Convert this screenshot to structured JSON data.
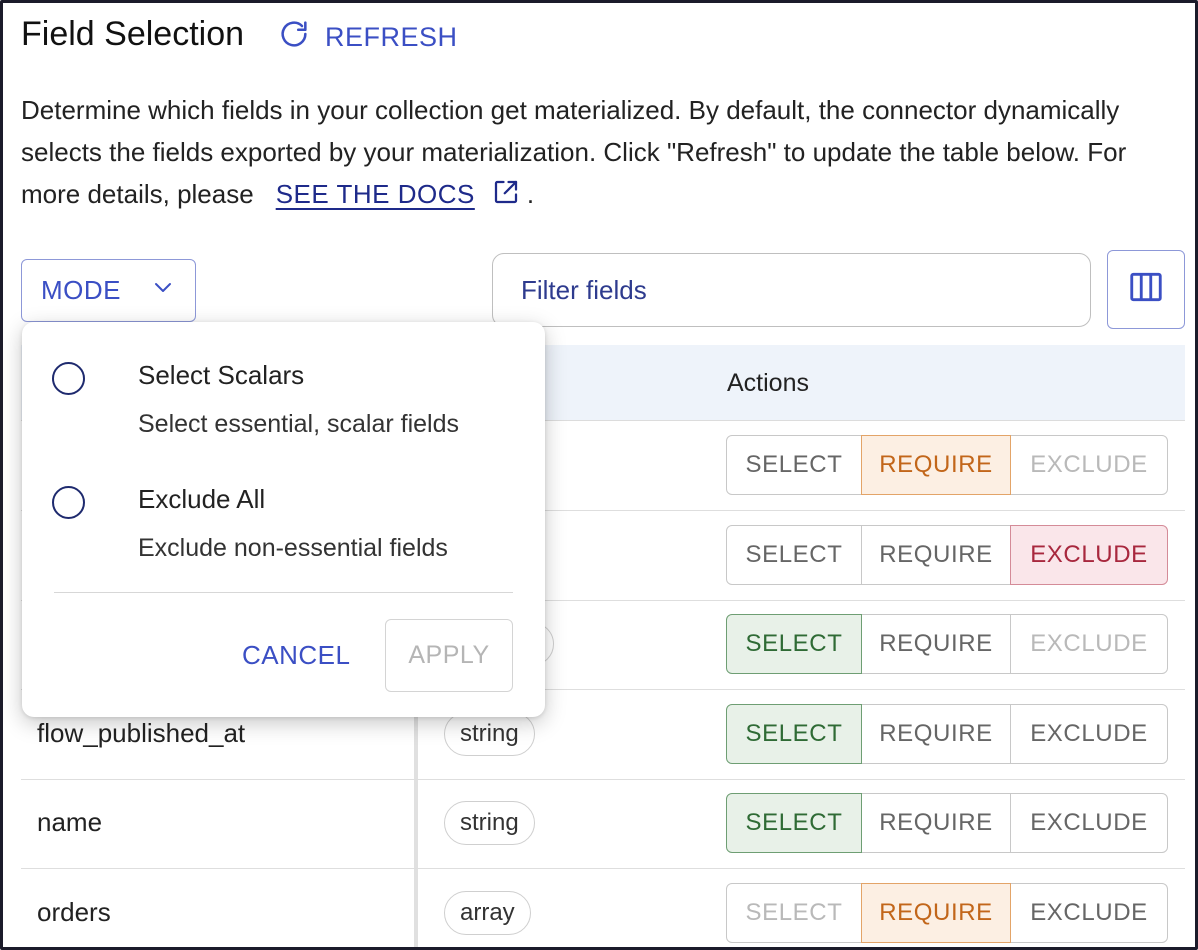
{
  "header": {
    "title": "Field Selection",
    "refresh_label": "REFRESH"
  },
  "description": {
    "text": "Determine which fields in your collection get materialized. By default, the connector dynamically selects the fields exported by your materialization. Click \"Refresh\" to update the table below. For more details, please",
    "link_label": "SEE THE DOCS",
    "suffix": "."
  },
  "toolbar": {
    "mode_label": "MODE",
    "filter_placeholder": "Filter fields"
  },
  "table": {
    "actions_header": "Actions",
    "action_labels": {
      "select": "SELECT",
      "require": "REQUIRE",
      "exclude": "EXCLUDE"
    },
    "rows": [
      {
        "field": "",
        "type": "",
        "state": "require"
      },
      {
        "field": "",
        "type": "",
        "state": "exclude"
      },
      {
        "field": "",
        "type": "",
        "state": "select"
      },
      {
        "field": "flow_published_at",
        "type": "string",
        "state": "select"
      },
      {
        "field": "name",
        "type": "string",
        "state": "select"
      },
      {
        "field": "orders",
        "type": "array",
        "state": "require"
      }
    ]
  },
  "mode_menu": {
    "options": [
      {
        "label": "Select Scalars",
        "description": "Select essential, scalar fields"
      },
      {
        "label": "Exclude All",
        "description": "Exclude non-essential fields"
      }
    ],
    "cancel_label": "CANCEL",
    "apply_label": "APPLY"
  },
  "colors": {
    "accent": "#3b4fc4",
    "select_active": "#2f6b35",
    "require_active": "#c2661a",
    "exclude_active": "#a8283e"
  }
}
